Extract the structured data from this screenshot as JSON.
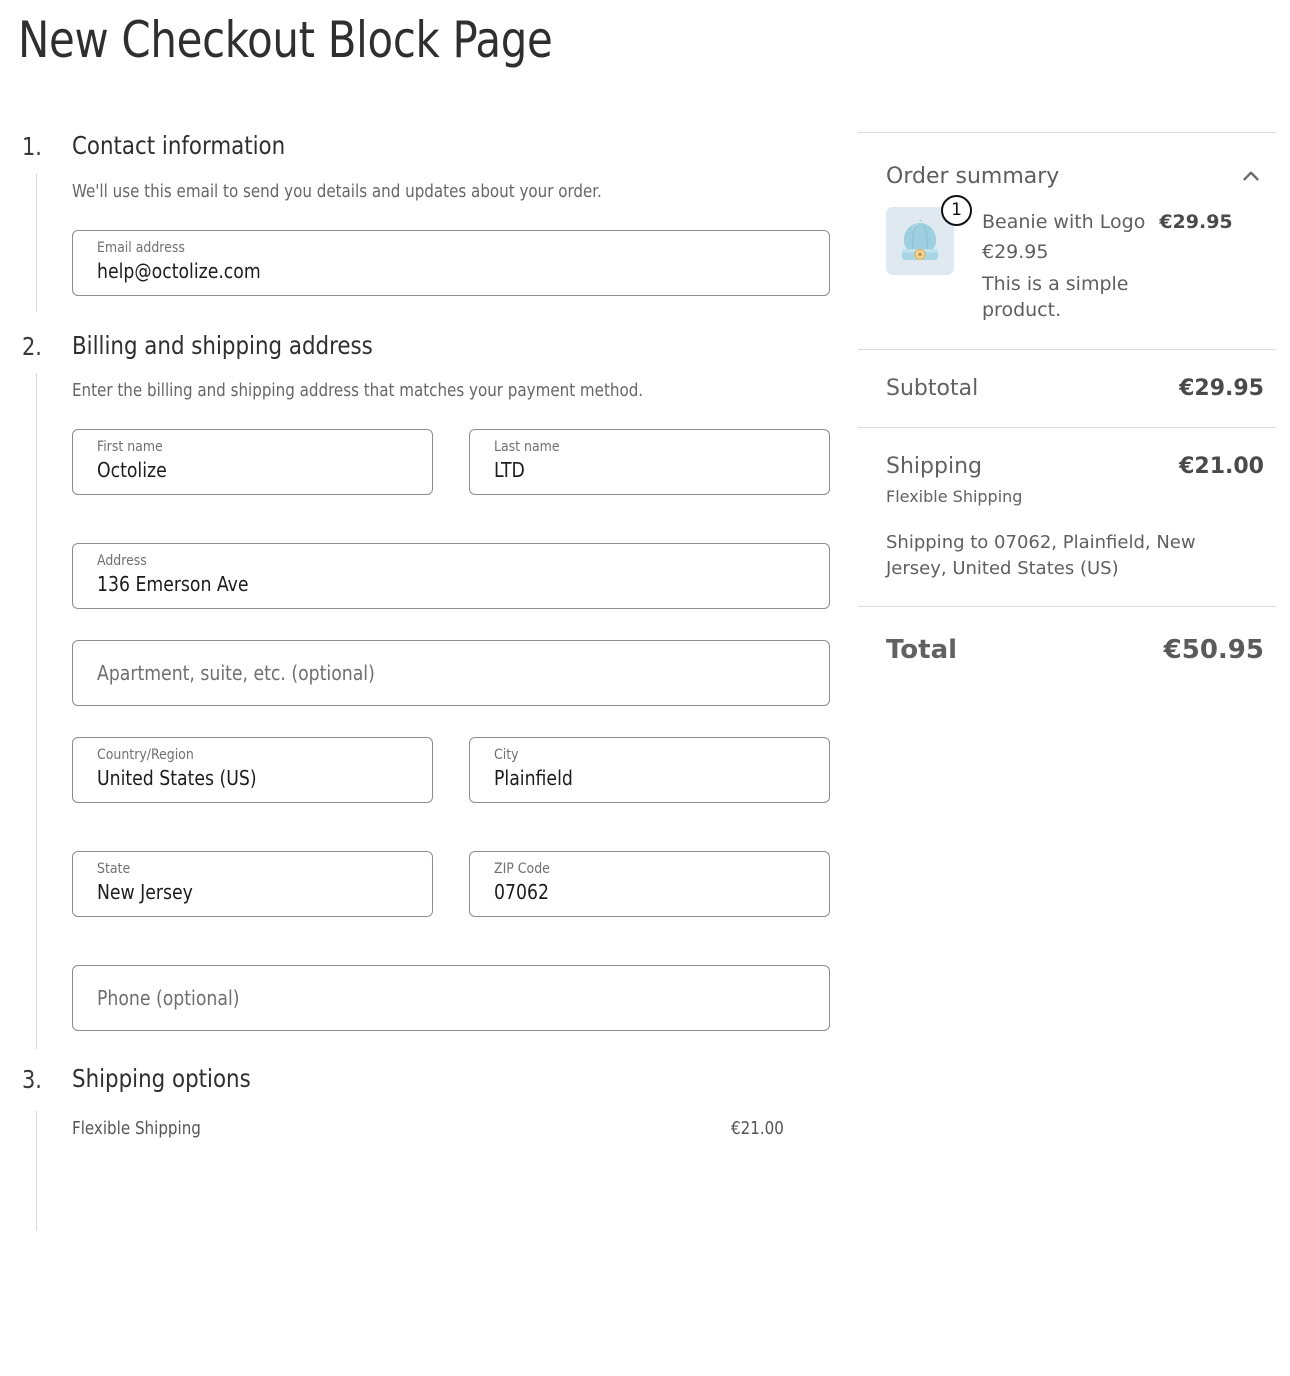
{
  "page": {
    "title": "New Checkout Block Page"
  },
  "steps": [
    {
      "number": "1.",
      "title": "Contact information",
      "description": "We'll use this email to send you details and updates about your order.",
      "fields": [
        {
          "label": "Email address",
          "value": "help@octolize.com",
          "placeholder": ""
        }
      ]
    },
    {
      "number": "2.",
      "title": "Billing and shipping address",
      "description": "Enter the billing and shipping address that matches your payment method.",
      "fields": [
        {
          "label": "First name",
          "value": "Octolize",
          "placeholder": ""
        },
        {
          "label": "Last name",
          "value": "LTD",
          "placeholder": ""
        },
        {
          "label": "Address",
          "value": "136 Emerson Ave",
          "placeholder": ""
        },
        {
          "label": "",
          "value": "",
          "placeholder": "Apartment, suite, etc. (optional)"
        },
        {
          "label": "Country/Region",
          "value": "United States (US)",
          "placeholder": ""
        },
        {
          "label": "City",
          "value": "Plainfield",
          "placeholder": ""
        },
        {
          "label": "State",
          "value": "New Jersey",
          "placeholder": ""
        },
        {
          "label": "ZIP Code",
          "value": "07062",
          "placeholder": ""
        },
        {
          "label": "",
          "value": "",
          "placeholder": "Phone (optional)"
        }
      ]
    },
    {
      "number": "3.",
      "title": "Shipping options",
      "options": [
        {
          "label": "Flexible Shipping",
          "price": "€21.00"
        }
      ]
    }
  ],
  "order_summary": {
    "title": "Order summary",
    "toggle_icon": "chevron-up-icon",
    "items": [
      {
        "quantity": "1",
        "name": "Beanie with Logo",
        "line_total": "€29.95",
        "unit_price": "€29.95",
        "description": "This is a simple product.",
        "image_alt": "beanie-product-thumbnail"
      }
    ],
    "subtotal": {
      "label": "Subtotal",
      "value": "€29.95"
    },
    "shipping": {
      "label": "Shipping",
      "value": "€21.00",
      "method": "Flexible Shipping",
      "destination": "Shipping to 07062, Plainfield, New Jersey, United States (US)"
    },
    "total": {
      "label": "Total",
      "value": "€50.95"
    }
  },
  "colors": {
    "text_primary": "#2b2b2b",
    "text_muted": "#676767",
    "border_field": "#8d8d8d",
    "divider": "#dcdcdc",
    "thumb_bg": "#dfe9ef",
    "beanie": "#8fc5d8"
  }
}
